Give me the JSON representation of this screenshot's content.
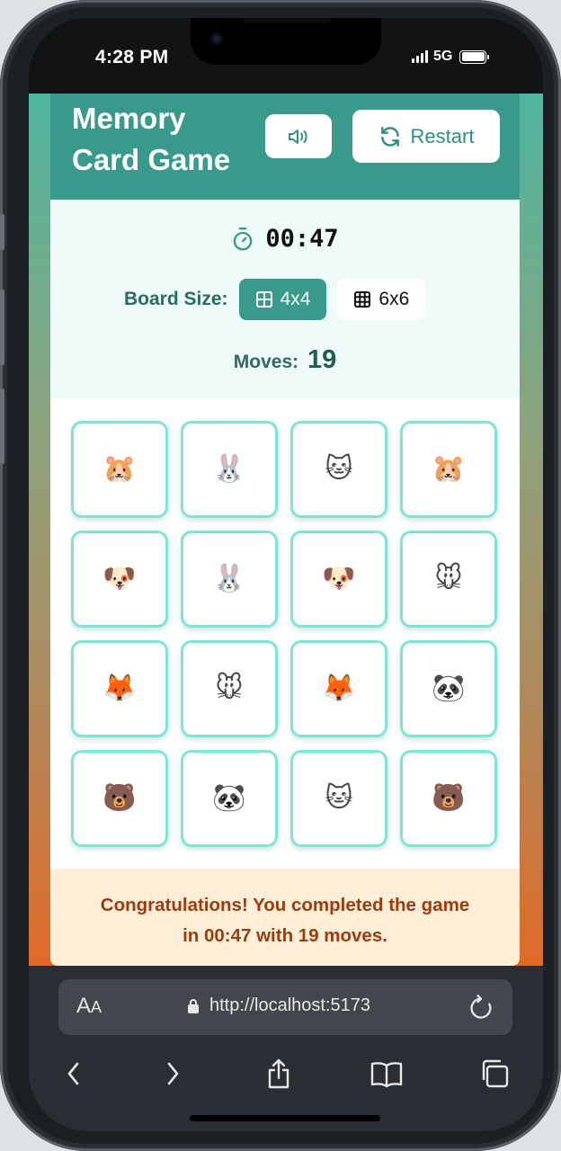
{
  "status_bar": {
    "time": "4:28 PM",
    "network": "5G"
  },
  "app": {
    "title_line1": "Memory",
    "title_line2": "Card Game",
    "restart_label": "Restart",
    "timer": "00:47",
    "board_size_label": "Board Size:",
    "size_options": [
      {
        "label": "4x4",
        "selected": true
      },
      {
        "label": "6x6",
        "selected": false
      }
    ],
    "moves_label": "Moves:",
    "moves_value": "19",
    "cards": [
      [
        "🐹",
        "🐰",
        "🐱",
        "🐹"
      ],
      [
        "🐶",
        "🐰",
        "🐶",
        "🐭"
      ],
      [
        "🦊",
        "🐭",
        "🦊",
        "🐼"
      ],
      [
        "🐻",
        "🐼",
        "🐱",
        "🐻"
      ]
    ],
    "congrats_line1": "Congratulations! You completed the game",
    "congrats_line2": "in 00:47 with 19 moves."
  },
  "browser": {
    "aa_label": "A",
    "aa_small": "A",
    "url": "http://localhost:5173"
  },
  "icons": {
    "sound": "speaker-icon",
    "restart": "refresh-icon",
    "timer": "stopwatch-icon",
    "grid": "grid-icon",
    "lock": "lock-icon",
    "reload": "reload-icon",
    "back": "chevron-left-icon",
    "forward": "chevron-right-icon",
    "share": "share-icon",
    "bookmarks": "book-icon",
    "tabs": "tabs-icon"
  },
  "colors": {
    "header": "#399a8b",
    "accent": "#3a9a8b",
    "card_border": "#7ee5d3",
    "congrats_text": "#9a3b10"
  }
}
